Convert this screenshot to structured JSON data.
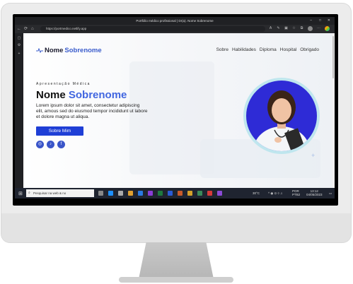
{
  "browser": {
    "title": "Portfólio médico profissional | Dr(a). Nome Sobrenome",
    "url": "https://portmedico.netlify.app"
  },
  "site": {
    "logo_first": "Nome",
    "logo_second": "Sobrenome",
    "nav": [
      "Sobre",
      "Habilidades",
      "Diploma",
      "Hospital",
      "Obrigado"
    ],
    "kicker": "Apresentação Médica",
    "heading_first": "Nome",
    "heading_second": "Sobrenome",
    "paragraph": "Lorem ipsum dolor sit amet, consectetur adipiscing elit, amous sed do eiusmod tempor incididunt ut labore et dolore magna ut aliqua.",
    "cta": "Sobre Mim",
    "social_icons": [
      "instagram-icon",
      "tiktok-icon",
      "facebook-icon"
    ]
  },
  "taskbar": {
    "search_placeholder": "Pesquisar na web & no",
    "weather": "30°C",
    "language_1": "POR",
    "language_2": "PTB2",
    "time": "13:12",
    "date": "04/05/2023"
  },
  "colors": {
    "accent_blue": "#3a5ccc",
    "button_blue": "#1f3fd6",
    "avatar_bg": "#2e2bd6",
    "ring": "#bfe6ee"
  }
}
